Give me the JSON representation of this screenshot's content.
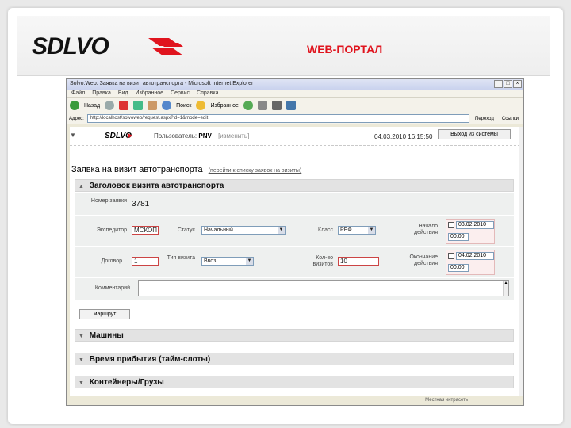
{
  "slide": {
    "title": "WEB-ПОРТАЛ",
    "logo_text": "SDLVO",
    "brand_color": "#e0141e"
  },
  "browser": {
    "title": "Solvo.Web: Заявка на визит автотранспорта - Microsoft Internet Explorer",
    "menu": [
      "Файл",
      "Правка",
      "Вид",
      "Избранное",
      "Сервис",
      "Справка"
    ],
    "toolbar": {
      "back": "Назад",
      "search": "Поиск",
      "favorites": "Избранное"
    },
    "address_label": "Адрес:",
    "address_value": "http://localhost/solvoweb/request.aspx?id=1&mode=edit",
    "go_label": "Переход",
    "links_label": "Ссылки",
    "status_zone": "Местная интрасеть"
  },
  "portal": {
    "user_label": "Пользователь:",
    "user_name": "PNV",
    "change_user": "[изменить]",
    "datetime": "04.03.2010 16:15:50",
    "exit_button": "Выход из системы",
    "request_title": "Заявка на визит автотранспорта",
    "request_link": "(перейти к списку заявок на визиты)"
  },
  "sections": {
    "header": "Заголовок визита автотранспорта",
    "machines": "Машины",
    "arrival": "Время прибытия (тайм-слоты)",
    "containers": "Контейнеры/Грузы"
  },
  "form": {
    "request_number_label": "Номер заявки",
    "request_number": "3781",
    "forwarder_label": "Экспедитор",
    "forwarder_value": "МСКОП",
    "status_label": "Статус",
    "status_value": "Начальный",
    "class_label": "Класс",
    "class_value": "РЕФ",
    "start_label": "Начало действия",
    "start_date": "03.02.2010",
    "start_time": "00:00",
    "contract_label": "Договор",
    "contract_value": "1",
    "visit_type_label": "Тип визита",
    "visit_type_value": "Ввоз",
    "count_label": "Кол-во визитов",
    "count_value": "10",
    "end_label": "Окончание действия",
    "end_date": "04.02.2010",
    "end_time": "00:00",
    "comment_label": "Комментарий",
    "route_button": "маршрут"
  }
}
